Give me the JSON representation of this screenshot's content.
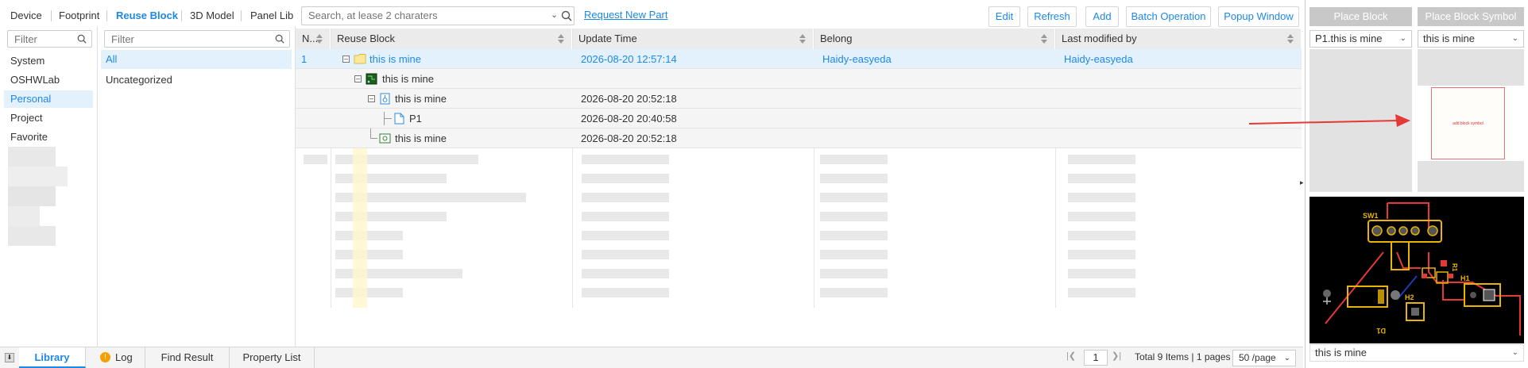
{
  "top_tabs": [
    {
      "label": "Device"
    },
    {
      "label": "Footprint"
    },
    {
      "label": "Reuse Block"
    },
    {
      "label": "3D Model"
    },
    {
      "label": "Panel Lib"
    }
  ],
  "search": {
    "placeholder": "Search, at lease 2 charaters"
  },
  "request_link": "Request New Part",
  "toolbar": {
    "edit": "Edit",
    "refresh": "Refresh",
    "add": "Add",
    "batch": "Batch Operation",
    "popup": "Popup Window"
  },
  "left": {
    "filter_placeholder": "Filter",
    "items": [
      {
        "label": "System"
      },
      {
        "label": "OSHWLab"
      },
      {
        "label": "Personal"
      },
      {
        "label": "Project"
      },
      {
        "label": "Favorite"
      }
    ]
  },
  "middle": {
    "filter_placeholder": "Filter",
    "items": [
      {
        "label": "All"
      },
      {
        "label": "Uncategorized"
      }
    ]
  },
  "grid": {
    "headers": [
      "N...",
      "Reuse Block",
      "Update Time",
      "Belong",
      "Last modified by"
    ],
    "rows": [
      {
        "no": "1",
        "name": "this is mine",
        "time": "2026-08-20 12:57:14",
        "belong": "Haidy-easyeda",
        "modified": "Haidy-easyeda"
      },
      {
        "no": "",
        "name": "this is mine",
        "time": "",
        "belong": "",
        "modified": ""
      },
      {
        "no": "",
        "name": "this is mine",
        "time": "2026-08-20 20:52:18",
        "belong": "",
        "modified": ""
      },
      {
        "no": "",
        "name": "P1",
        "time": "2026-08-20 20:40:58",
        "belong": "",
        "modified": ""
      },
      {
        "no": "",
        "name": "this is mine",
        "time": "2026-08-20 20:52:18",
        "belong": "",
        "modified": ""
      }
    ]
  },
  "right": {
    "place_block": "Place Block",
    "place_symbol": "Place Block Symbol",
    "select_left": "P1.this is mine",
    "select_right": "this is mine",
    "symbol_caption": "add block symbol",
    "bottom_select": "this is mine",
    "pcb_labels": {
      "sw1": "SW1",
      "d1": "D1",
      "h1": "H1",
      "h2": "H2",
      "r1": "R1"
    }
  },
  "bottom": {
    "tabs": [
      {
        "label": "Library"
      },
      {
        "label": "Log"
      },
      {
        "label": "Find Result"
      },
      {
        "label": "Property List"
      }
    ],
    "page": "1",
    "total": "Total 9 Items | 1 pages",
    "per_page": "50 /page"
  },
  "colors": {
    "accent": "#1e88e5",
    "selected_row": "#e3f1fd",
    "pcb_bg": "#000000",
    "pcb_pad": "#e8b400",
    "pcb_trace": "#ff0000",
    "arrow": "#e53935"
  }
}
